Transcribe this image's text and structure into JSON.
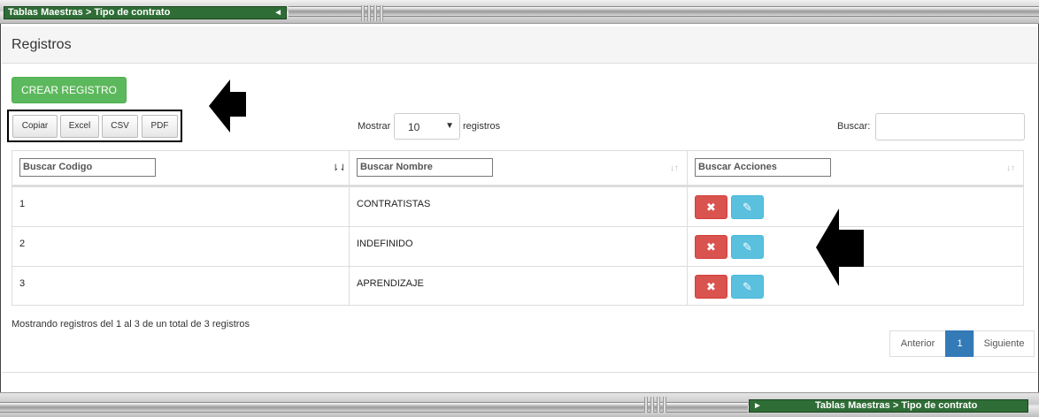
{
  "breadcrumb": "Tablas Maestras > Tipo de contrato",
  "page_title": "Registros",
  "create_button": "CREAR REGISTRO",
  "export_buttons": [
    "Copiar",
    "Excel",
    "CSV",
    "PDF"
  ],
  "length": {
    "before": "Mostrar",
    "value": "10",
    "after": "registros"
  },
  "search": {
    "label": "Buscar:",
    "value": ""
  },
  "columns": [
    {
      "placeholder": "Buscar Codigo",
      "sort": "active"
    },
    {
      "placeholder": "Buscar Nombre",
      "sort": "both"
    },
    {
      "placeholder": "Buscar Acciones",
      "sort": "both"
    }
  ],
  "rows": [
    {
      "codigo": "1",
      "nombre": "CONTRATISTAS"
    },
    {
      "codigo": "2",
      "nombre": "INDEFINIDO"
    },
    {
      "codigo": "3",
      "nombre": "APRENDIZAJE"
    }
  ],
  "info_text": "Mostrando registros del 1 al 3 de un total de 3 registros",
  "pagination": {
    "previous": "Anterior",
    "current": "1",
    "next": "Siguiente"
  },
  "icons": {
    "delete": "delete-icon",
    "edit": "edit-icon"
  },
  "colors": {
    "create": "#5cb85c",
    "delete": "#d9534f",
    "edit": "#5bc0de",
    "page_current": "#337ab7",
    "breadcrumb_bg": "#2f6d36"
  }
}
